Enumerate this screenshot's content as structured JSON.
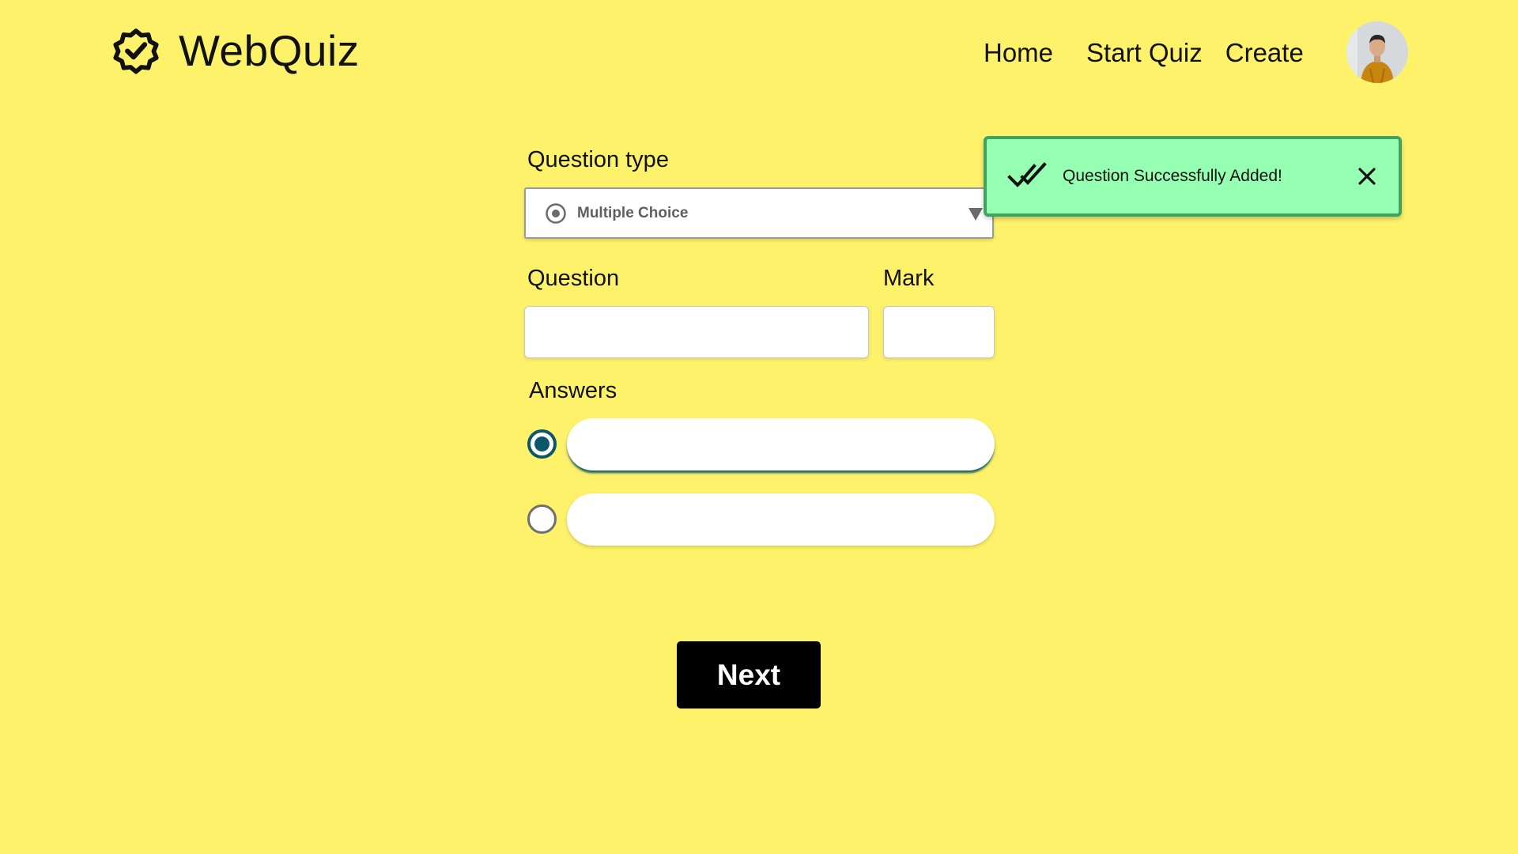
{
  "header": {
    "brand": "WebQuiz",
    "logo_icon": "verified-badge-icon",
    "nav": {
      "home": "Home",
      "start_quiz": "Start Quiz",
      "create": "Create"
    },
    "avatar_icon": "user-avatar"
  },
  "form": {
    "question_type_label": "Question type",
    "question_type_value": "Multiple Choice",
    "question_label": "Question",
    "question_value": "",
    "mark_label": "Mark",
    "mark_value": "",
    "answers_label": "Answers",
    "answers": [
      {
        "value": "",
        "selected": true
      },
      {
        "value": "",
        "selected": false
      }
    ],
    "next_label": "Next"
  },
  "toast": {
    "message": "Question Successfully Added!",
    "icon": "double-check-icon",
    "close_icon": "close-icon"
  },
  "colors": {
    "background": "#fff26b",
    "toast_background": "#95ffb2",
    "toast_border": "#3ea360",
    "radio_accent": "#0b5668",
    "button": "#000000"
  }
}
